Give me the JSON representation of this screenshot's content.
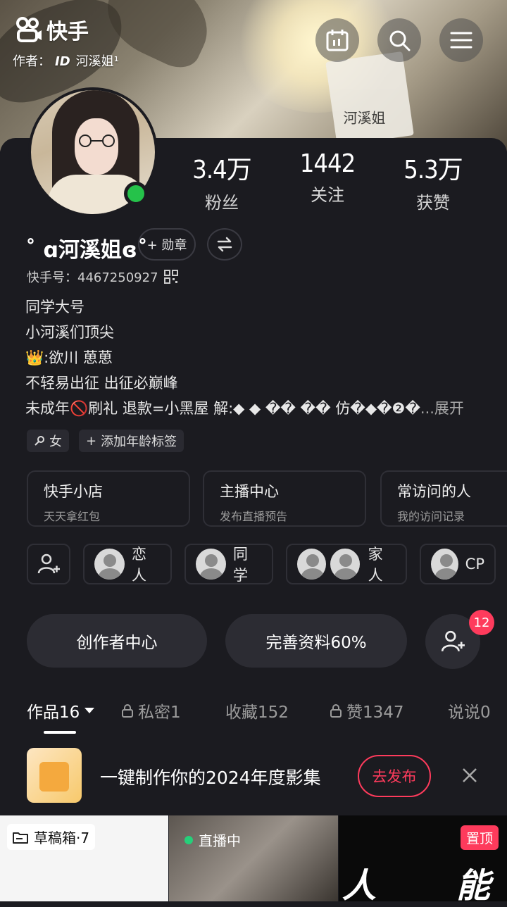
{
  "brand": {
    "name": "快手"
  },
  "author": {
    "prefix": "作者：",
    "id": "ID",
    "name": "河溪姐¹"
  },
  "hero_card_text": "河溪姐",
  "profile": {
    "nickname": "˚ ɑ河溪姐ɞ˚",
    "medal_label": "+ 勋章",
    "kuaishou_id": "快手号：4467250927",
    "stats": [
      {
        "value": "3.4万",
        "label": "粉丝"
      },
      {
        "value": "1442",
        "label": "关注"
      },
      {
        "value": "5.3万",
        "label": "获赞"
      }
    ],
    "bio_lines": [
      "同学大号",
      "小河溪们顶尖",
      "👑:欲川 葸葸",
      "不轻易出征 出征必巅峰",
      "未成年🚫刷礼 退款=小黑屋 解:◆ ◆ �� �� 仿�◆�❷�"
    ],
    "bio_more": "...展开",
    "tags": [
      "女",
      "添加年龄标签"
    ]
  },
  "services": [
    {
      "title": "快手小店",
      "subtitle": "天天拿红包"
    },
    {
      "title": "主播中心",
      "subtitle": "发布直播预告"
    },
    {
      "title": "常访问的人",
      "subtitle": "我的访问记录"
    }
  ],
  "relations": [
    "恋人",
    "同学",
    "家人",
    "CP"
  ],
  "actions": {
    "creator_center": "创作者中心",
    "complete_profile": "完善资料60%",
    "friend_badge": "12"
  },
  "tabs": [
    {
      "label": "作品16",
      "locked": false,
      "active": true
    },
    {
      "label": "私密1",
      "locked": true,
      "active": false
    },
    {
      "label": "收藏152",
      "locked": false,
      "active": false
    },
    {
      "label": "赞1347",
      "locked": true,
      "active": false
    },
    {
      "label": "说说0",
      "locked": false,
      "active": false
    }
  ],
  "promo": {
    "text": "一键制作你的2024年度影集",
    "button": "去发布"
  },
  "grid": {
    "draft_label": "草稿箱·7",
    "live_label": "直播中",
    "pinned_label": "置顶",
    "cell1_glyph": "人",
    "cell3_glyph": "能"
  },
  "colors": {
    "accent": "#fe3b5c",
    "online": "#25c24a",
    "background": "#1b1b20"
  }
}
